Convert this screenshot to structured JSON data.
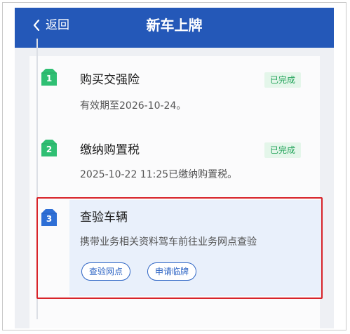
{
  "header": {
    "back_label": "返回",
    "title": "新车上牌"
  },
  "steps": [
    {
      "num": "1",
      "title": "购买交强险",
      "desc": "有效期至2026-10-24。",
      "status": "已完成"
    },
    {
      "num": "2",
      "title": "缴纳购置税",
      "desc": "2025-10-22 11:25已缴纳购置税。",
      "status": "已完成"
    },
    {
      "num": "3",
      "title": "查验车辆",
      "desc": "携带业务相关资料驾车前往业务网点查验",
      "actions": [
        "查验网点",
        "申请临牌"
      ]
    }
  ],
  "colors": {
    "header": "#2458b8",
    "done_badge": "#2fbf73",
    "active_badge": "#2e6fd6",
    "status_text": "#23a35a",
    "highlight_border": "#d8242a"
  }
}
